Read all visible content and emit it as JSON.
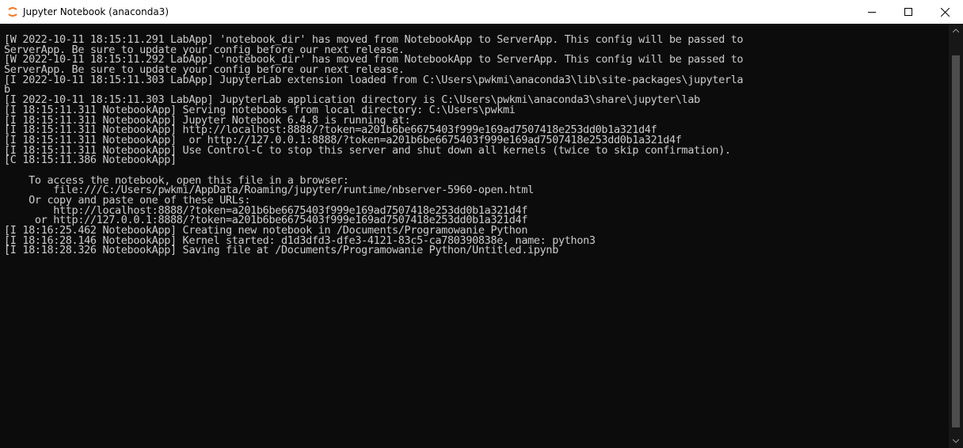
{
  "window": {
    "title": "Jupyter Notebook (anaconda3)",
    "icon": "jupyter-icon",
    "controls": [
      "minimize-icon",
      "maximize-icon",
      "close-icon"
    ]
  },
  "colors": {
    "console_bg": "#0c0c0c",
    "console_text": "#cccccc",
    "titlebar_bg": "#ffffff",
    "jupyter_orange": "#f37726"
  },
  "console": {
    "lines": [
      "[W 2022-10-11 18:15:11.291 LabApp] 'notebook_dir' has moved from NotebookApp to ServerApp. This config will be passed to",
      "ServerApp. Be sure to update your config before our next release.",
      "[W 2022-10-11 18:15:11.292 LabApp] 'notebook_dir' has moved from NotebookApp to ServerApp. This config will be passed to",
      "ServerApp. Be sure to update your config before our next release.",
      "[I 2022-10-11 18:15:11.303 LabApp] JupyterLab extension loaded from C:\\Users\\pwkmi\\anaconda3\\lib\\site-packages\\jupyterla",
      "b",
      "[I 2022-10-11 18:15:11.303 LabApp] JupyterLab application directory is C:\\Users\\pwkmi\\anaconda3\\share\\jupyter\\lab",
      "[I 18:15:11.311 NotebookApp] Serving notebooks from local directory: C:\\Users\\pwkmi",
      "[I 18:15:11.311 NotebookApp] Jupyter Notebook 6.4.8 is running at:",
      "[I 18:15:11.311 NotebookApp] http://localhost:8888/?token=a201b6be6675403f999e169ad7507418e253dd0b1a321d4f",
      "[I 18:15:11.311 NotebookApp]  or http://127.0.0.1:8888/?token=a201b6be6675403f999e169ad7507418e253dd0b1a321d4f",
      "[I 18:15:11.311 NotebookApp] Use Control-C to stop this server and shut down all kernels (twice to skip confirmation).",
      "[C 18:15:11.386 NotebookApp]",
      "",
      "    To access the notebook, open this file in a browser:",
      "        file:///C:/Users/pwkmi/AppData/Roaming/jupyter/runtime/nbserver-5960-open.html",
      "    Or copy and paste one of these URLs:",
      "        http://localhost:8888/?token=a201b6be6675403f999e169ad7507418e253dd0b1a321d4f",
      "     or http://127.0.0.1:8888/?token=a201b6be6675403f999e169ad7507418e253dd0b1a321d4f",
      "[I 18:16:25.462 NotebookApp] Creating new notebook in /Documents/Programowanie Python",
      "[I 18:16:28.146 NotebookApp] Kernel started: d1d3dfd3-dfe3-4121-83c5-ca780390838e, name: python3",
      "[I 18:18:28.326 NotebookApp] Saving file at /Documents/Programowanie Python/Untitled.ipynb"
    ]
  }
}
